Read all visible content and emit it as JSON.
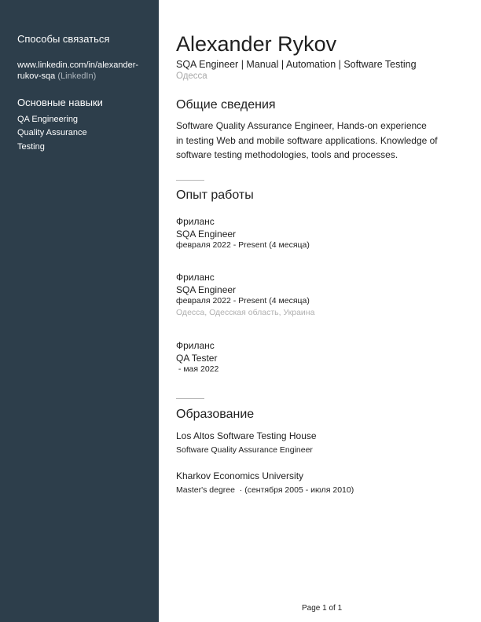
{
  "sidebar": {
    "contacts_heading": "Способы связаться",
    "linkedin_line1": "www.linkedin.com/in/alexander-",
    "linkedin_line2": "rukov-sqa",
    "linkedin_suffix": "(LinkedIn)",
    "skills_heading": "Основные навыки",
    "skills": [
      "QA Engineering",
      "Quality Assurance",
      "Testing"
    ]
  },
  "header": {
    "name": "Alexander Rykov",
    "headline": "SQA Engineer | Manual | Automation | Software Testing",
    "location": "Одесса"
  },
  "summary": {
    "title": "Общие сведения",
    "lines": [
      "Software Quality Assurance Engineer, Hands-on experience",
      "in testing Web and mobile software applications. Knowledge of",
      "software testing methodologies, tools and processes."
    ]
  },
  "experience": {
    "title": "Опыт работы",
    "jobs": [
      {
        "company": "Фриланс",
        "role": "SQA Engineer",
        "dates": "февраля 2022 - Present (4 месяца)",
        "location": ""
      },
      {
        "company": "Фриланс",
        "role": "SQA Engineer",
        "dates": "февраля 2022 - Present (4 месяца)",
        "location": "Одесса, Одесская область, Украина"
      },
      {
        "company": "Фриланс",
        "role": "QA Tester",
        "dates": " - мая 2022",
        "location": ""
      }
    ]
  },
  "education": {
    "title": "Образование",
    "schools": [
      {
        "name": "Los Altos Software Testing House",
        "degree": "Software Quality Assurance Engineer"
      },
      {
        "name": "Kharkov Economics University",
        "degree": "Master's degree  · (сентября 2005 - июля 2010)"
      }
    ]
  },
  "footer": {
    "page": "Page 1 of 1"
  }
}
